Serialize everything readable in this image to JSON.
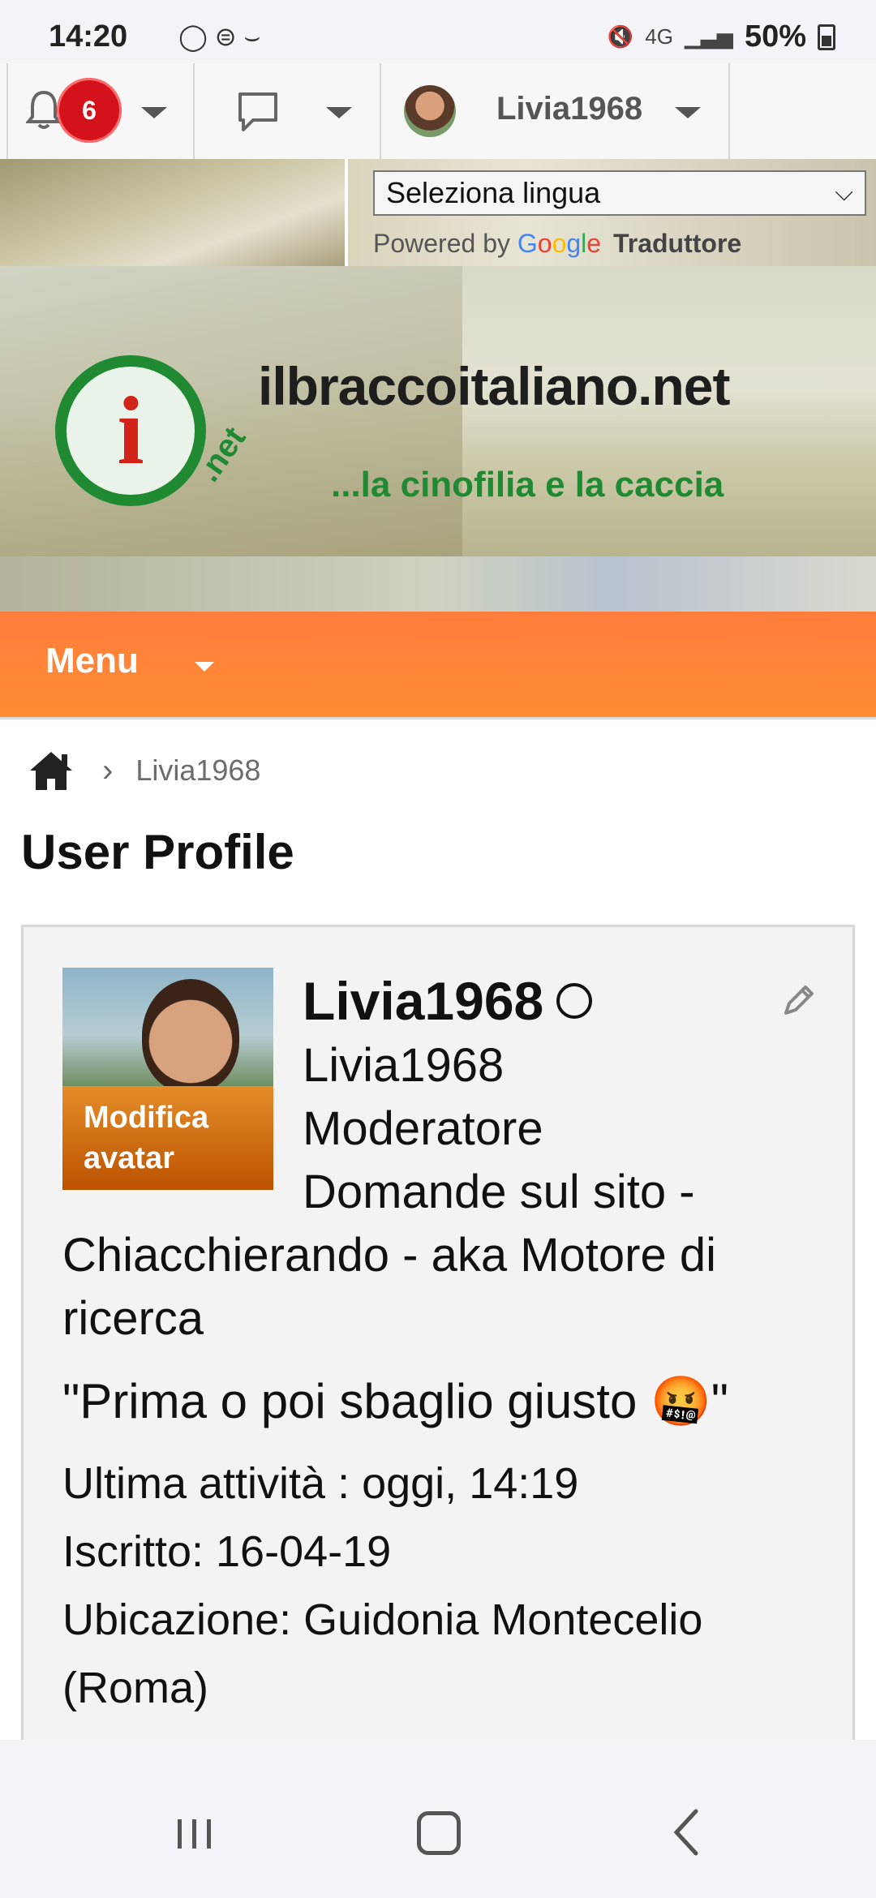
{
  "status_bar": {
    "time": "14:20",
    "network": "4G",
    "battery": "50%"
  },
  "toolbar": {
    "notification_count": "6",
    "username": "Livia1968"
  },
  "translate": {
    "select_value": "Seleziona lingua",
    "powered_by": "Powered by",
    "google": [
      "G",
      "o",
      "o",
      "g",
      "l",
      "e"
    ],
    "translator": "Traduttore"
  },
  "banner": {
    "logo_letter": "i",
    "logo_net": ".net",
    "site_name": "ilbraccoitaliano.net",
    "tagline": "...la cinofilia e la caccia"
  },
  "menu": {
    "label": "Menu"
  },
  "breadcrumb": {
    "current": "Livia1968"
  },
  "page": {
    "title": "User Profile"
  },
  "profile": {
    "username": "Livia1968",
    "display_name": "Livia1968",
    "role": "Moderatore",
    "forums": "Domande sul sito - Chiacchierando - aka Motore di ricerca",
    "motto": "\"Prima o poi sbaglio giusto 🤬\"",
    "last_activity": "Ultima attività  : oggi, 14:19",
    "joined": "Iscritto: 16-04-19",
    "location": "Ubicazione: Guidonia Montecelio (Roma)",
    "avatar_edit_label": "Modifica avatar"
  },
  "colors": {
    "menu_orange": "#ff8534",
    "badge_red": "#d3121c",
    "logo_green": "#1f8a32",
    "avatar_edit_orange": "#d06a10"
  }
}
